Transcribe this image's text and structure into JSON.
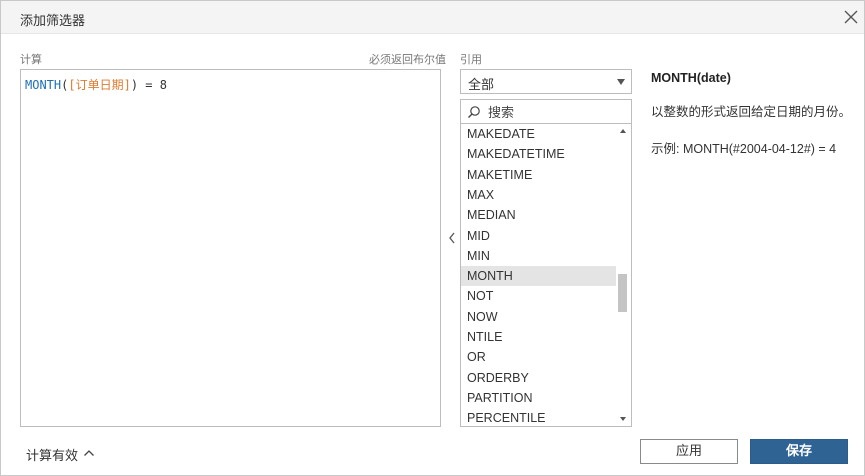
{
  "dialog": {
    "title": "添加筛选器"
  },
  "calculation": {
    "label": "计算",
    "hint": "必须返回布尔值",
    "formula": {
      "function": "MONTH",
      "open_paren": "(",
      "field": "[订单日期]",
      "close_rest": ") = 8"
    }
  },
  "reference": {
    "label": "引用",
    "category_selected": "全部",
    "search_placeholder": "搜索",
    "functions": [
      "MAKEDATE",
      "MAKEDATETIME",
      "MAKETIME",
      "MAX",
      "MEDIAN",
      "MID",
      "MIN",
      "MONTH",
      "NOT",
      "NOW",
      "NTILE",
      "OR",
      "ORDERBY",
      "PARTITION",
      "PERCENTILE"
    ],
    "selected_function": "MONTH"
  },
  "help": {
    "signature": "MONTH(date)",
    "description": "以整数的形式返回给定日期的月份。",
    "example": "示例: MONTH(#2004-04-12#) = 4"
  },
  "footer": {
    "status": "计算有效",
    "apply_label": "应用",
    "save_label": "保存"
  },
  "colors": {
    "primary_button": "#2e6394",
    "function_token": "#1f6fb5",
    "field_token": "#e07a2e",
    "selected_row": "#e4e4e4"
  }
}
